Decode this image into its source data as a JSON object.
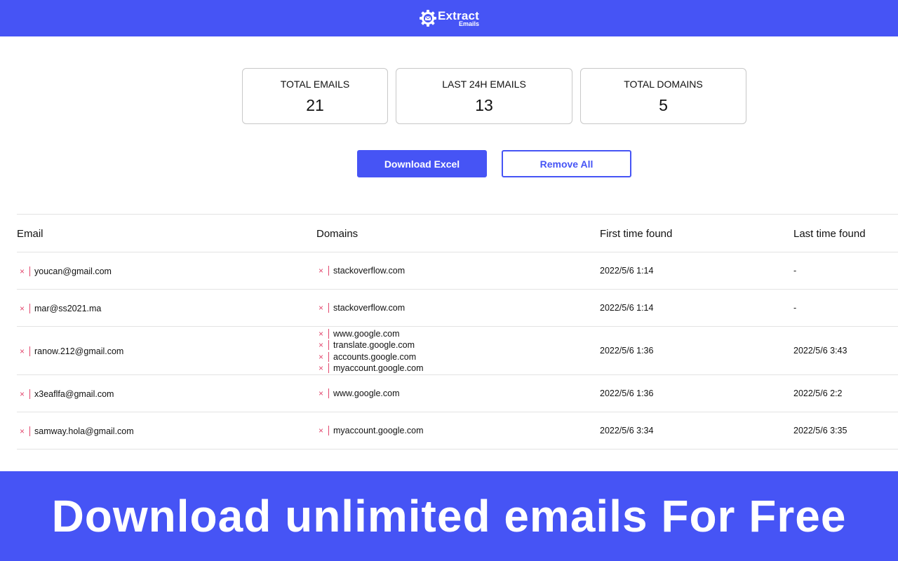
{
  "header": {
    "logo_line1": "Extract",
    "logo_line2": "Emails"
  },
  "stats": [
    {
      "label": "TOTAL EMAILS",
      "value": "21"
    },
    {
      "label": "LAST 24H EMAILS",
      "value": "13"
    },
    {
      "label": "TOTAL DOMAINS",
      "value": "5"
    }
  ],
  "actions": {
    "download_label": "Download Excel",
    "remove_label": "Remove All"
  },
  "table": {
    "columns": [
      "Email",
      "Domains",
      "First time found",
      "Last time found"
    ],
    "rows": [
      {
        "email": "youcan@gmail.com",
        "domains": [
          "stackoverflow.com"
        ],
        "first": "2022/5/6 1:14",
        "last": "-"
      },
      {
        "email": "mar@ss2021.ma",
        "domains": [
          "stackoverflow.com"
        ],
        "first": "2022/5/6 1:14",
        "last": "-"
      },
      {
        "email": "ranow.212@gmail.com",
        "domains": [
          "www.google.com",
          "translate.google.com",
          "accounts.google.com",
          "myaccount.google.com"
        ],
        "first": "2022/5/6 1:36",
        "last": "2022/5/6 3:43"
      },
      {
        "email": "x3eaflfa@gmail.com",
        "domains": [
          "www.google.com"
        ],
        "first": "2022/5/6 1:36",
        "last": "2022/5/6 2:2"
      },
      {
        "email": "samway.hola@gmail.com",
        "domains": [
          "myaccount.google.com"
        ],
        "first": "2022/5/6 3:34",
        "last": "2022/5/6 3:35"
      }
    ]
  },
  "delete_glyph": "×",
  "banner": {
    "text": "Download unlimited emails For Free"
  },
  "colors": {
    "brand": "#4654f5",
    "delete": "#e2486e",
    "border": "#c8c8c8"
  }
}
